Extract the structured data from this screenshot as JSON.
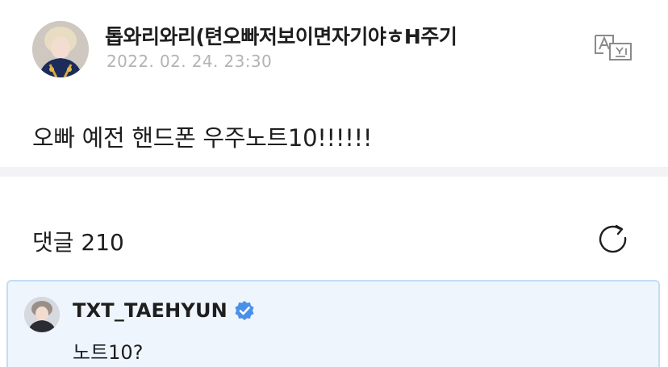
{
  "post": {
    "author_name": "톱와리와리(텬오빠저보이면자기야ㅎH주기",
    "date": "2022. 02. 24. 23:30",
    "body": "오빠 예전 핸드폰 우주노트10!!!!!!",
    "translate_icon": "translate-icon"
  },
  "comments": {
    "label": "댓글 210",
    "refresh_icon": "refresh-icon",
    "items": [
      {
        "author": "TXT_TAEHYUN",
        "verified": true,
        "text": "노트10?"
      }
    ]
  },
  "colors": {
    "verified": "#4a90e8",
    "highlight_bg": "#eef5fd",
    "highlight_border": "#c5dcf3",
    "date_text": "#b3b3b3"
  }
}
